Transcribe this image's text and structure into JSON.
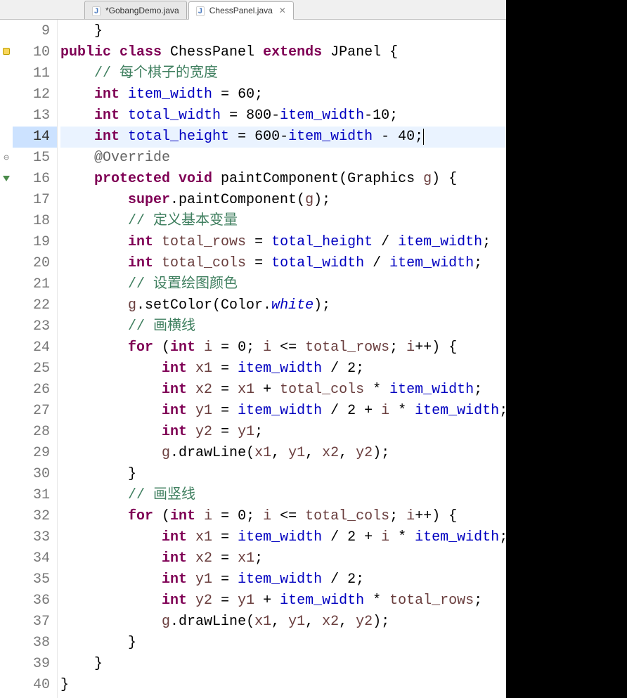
{
  "tabs": [
    {
      "label": "*GobangDemo.java",
      "active": false
    },
    {
      "label": "ChessPanel.java",
      "active": true
    }
  ],
  "gutter": {
    "lines": [
      "9",
      "10",
      "11",
      "12",
      "13",
      "14",
      "15",
      "16",
      "17",
      "18",
      "19",
      "20",
      "21",
      "22",
      "23",
      "24",
      "25",
      "26",
      "27",
      "28",
      "29",
      "30",
      "31",
      "32",
      "33",
      "34",
      "35",
      "36",
      "37",
      "38",
      "39",
      "40"
    ],
    "current_line": "14"
  },
  "markers": {
    "9": "",
    "10": "warn",
    "15": "fold",
    "16": "override"
  },
  "code": {
    "l9": {
      "indent": "    ",
      "tokens": [
        [
          "plain",
          "}"
        ]
      ]
    },
    "l10": {
      "indent": "",
      "tokens": [
        [
          "kw",
          "public class "
        ],
        [
          "plain",
          "ChessPanel "
        ],
        [
          "kw",
          "extends "
        ],
        [
          "plain",
          "JPanel {"
        ]
      ]
    },
    "l11": {
      "indent": "    ",
      "tokens": [
        [
          "comment",
          "// 每个棋子的宽度"
        ]
      ]
    },
    "l12": {
      "indent": "    ",
      "tokens": [
        [
          "kw",
          "int "
        ],
        [
          "field",
          "item_width"
        ],
        [
          "plain",
          " = 60;"
        ]
      ]
    },
    "l13": {
      "indent": "    ",
      "tokens": [
        [
          "kw",
          "int "
        ],
        [
          "field",
          "total_width"
        ],
        [
          "plain",
          " = 800-"
        ],
        [
          "field",
          "item_width"
        ],
        [
          "plain",
          "-10;"
        ]
      ]
    },
    "l14": {
      "indent": "    ",
      "tokens": [
        [
          "kw",
          "int "
        ],
        [
          "field",
          "total_height"
        ],
        [
          "plain",
          " = 600-"
        ],
        [
          "field",
          "item_width"
        ],
        [
          "plain",
          " - 40;"
        ]
      ]
    },
    "l15": {
      "indent": "    ",
      "tokens": [
        [
          "annot",
          "@Override"
        ]
      ]
    },
    "l16": {
      "indent": "    ",
      "tokens": [
        [
          "kw",
          "protected void "
        ],
        [
          "method",
          "paintComponent"
        ],
        [
          "plain",
          "(Graphics "
        ],
        [
          "local",
          "g"
        ],
        [
          "plain",
          ") {"
        ]
      ]
    },
    "l17": {
      "indent": "        ",
      "tokens": [
        [
          "kw",
          "super"
        ],
        [
          "plain",
          ".paintComponent("
        ],
        [
          "local",
          "g"
        ],
        [
          "plain",
          ");"
        ]
      ]
    },
    "l18": {
      "indent": "        ",
      "tokens": [
        [
          "comment",
          "// 定义基本变量"
        ]
      ]
    },
    "l19": {
      "indent": "        ",
      "tokens": [
        [
          "kw",
          "int "
        ],
        [
          "local",
          "total_rows"
        ],
        [
          "plain",
          " = "
        ],
        [
          "field",
          "total_height"
        ],
        [
          "plain",
          " / "
        ],
        [
          "field",
          "item_width"
        ],
        [
          "plain",
          ";"
        ]
      ]
    },
    "l20": {
      "indent": "        ",
      "tokens": [
        [
          "kw",
          "int "
        ],
        [
          "local",
          "total_cols"
        ],
        [
          "plain",
          " = "
        ],
        [
          "field",
          "total_width"
        ],
        [
          "plain",
          " / "
        ],
        [
          "field",
          "item_width"
        ],
        [
          "plain",
          ";"
        ]
      ]
    },
    "l21": {
      "indent": "        ",
      "tokens": [
        [
          "comment",
          "// 设置绘图颜色"
        ]
      ]
    },
    "l22": {
      "indent": "        ",
      "tokens": [
        [
          "local",
          "g"
        ],
        [
          "plain",
          ".setColor(Color."
        ],
        [
          "italic",
          "white"
        ],
        [
          "plain",
          ");"
        ]
      ]
    },
    "l23": {
      "indent": "        ",
      "tokens": [
        [
          "comment",
          "// 画横线"
        ]
      ]
    },
    "l24": {
      "indent": "        ",
      "tokens": [
        [
          "kw",
          "for "
        ],
        [
          "plain",
          "("
        ],
        [
          "kw",
          "int "
        ],
        [
          "local",
          "i"
        ],
        [
          "plain",
          " = 0; "
        ],
        [
          "local",
          "i"
        ],
        [
          "plain",
          " <= "
        ],
        [
          "local",
          "total_rows"
        ],
        [
          "plain",
          "; "
        ],
        [
          "local",
          "i"
        ],
        [
          "plain",
          "++) {"
        ]
      ]
    },
    "l25": {
      "indent": "            ",
      "tokens": [
        [
          "kw",
          "int "
        ],
        [
          "local",
          "x1"
        ],
        [
          "plain",
          " = "
        ],
        [
          "field",
          "item_width"
        ],
        [
          "plain",
          " / 2;"
        ]
      ]
    },
    "l26": {
      "indent": "            ",
      "tokens": [
        [
          "kw",
          "int "
        ],
        [
          "local",
          "x2"
        ],
        [
          "plain",
          " = "
        ],
        [
          "local",
          "x1"
        ],
        [
          "plain",
          " + "
        ],
        [
          "local",
          "total_cols"
        ],
        [
          "plain",
          " * "
        ],
        [
          "field",
          "item_width"
        ],
        [
          "plain",
          ";"
        ]
      ]
    },
    "l27": {
      "indent": "            ",
      "tokens": [
        [
          "kw",
          "int "
        ],
        [
          "local",
          "y1"
        ],
        [
          "plain",
          " = "
        ],
        [
          "field",
          "item_width"
        ],
        [
          "plain",
          " / 2 + "
        ],
        [
          "local",
          "i"
        ],
        [
          "plain",
          " * "
        ],
        [
          "field",
          "item_width"
        ],
        [
          "plain",
          ";"
        ]
      ]
    },
    "l28": {
      "indent": "            ",
      "tokens": [
        [
          "kw",
          "int "
        ],
        [
          "local",
          "y2"
        ],
        [
          "plain",
          " = "
        ],
        [
          "local",
          "y1"
        ],
        [
          "plain",
          ";"
        ]
      ]
    },
    "l29": {
      "indent": "            ",
      "tokens": [
        [
          "local",
          "g"
        ],
        [
          "plain",
          ".drawLine("
        ],
        [
          "local",
          "x1"
        ],
        [
          "plain",
          ", "
        ],
        [
          "local",
          "y1"
        ],
        [
          "plain",
          ", "
        ],
        [
          "local",
          "x2"
        ],
        [
          "plain",
          ", "
        ],
        [
          "local",
          "y2"
        ],
        [
          "plain",
          ");"
        ]
      ]
    },
    "l30": {
      "indent": "        ",
      "tokens": [
        [
          "plain",
          "}"
        ]
      ]
    },
    "l31": {
      "indent": "        ",
      "tokens": [
        [
          "comment",
          "// 画竖线"
        ]
      ]
    },
    "l32": {
      "indent": "        ",
      "tokens": [
        [
          "kw",
          "for "
        ],
        [
          "plain",
          "("
        ],
        [
          "kw",
          "int "
        ],
        [
          "local",
          "i"
        ],
        [
          "plain",
          " = 0; "
        ],
        [
          "local",
          "i"
        ],
        [
          "plain",
          " <= "
        ],
        [
          "local",
          "total_cols"
        ],
        [
          "plain",
          "; "
        ],
        [
          "local",
          "i"
        ],
        [
          "plain",
          "++) {"
        ]
      ]
    },
    "l33": {
      "indent": "            ",
      "tokens": [
        [
          "kw",
          "int "
        ],
        [
          "local",
          "x1"
        ],
        [
          "plain",
          " = "
        ],
        [
          "field",
          "item_width"
        ],
        [
          "plain",
          " / 2 + "
        ],
        [
          "local",
          "i"
        ],
        [
          "plain",
          " * "
        ],
        [
          "field",
          "item_width"
        ],
        [
          "plain",
          ";"
        ]
      ]
    },
    "l34": {
      "indent": "            ",
      "tokens": [
        [
          "kw",
          "int "
        ],
        [
          "local",
          "x2"
        ],
        [
          "plain",
          " = "
        ],
        [
          "local",
          "x1"
        ],
        [
          "plain",
          ";"
        ]
      ]
    },
    "l35": {
      "indent": "            ",
      "tokens": [
        [
          "kw",
          "int "
        ],
        [
          "local",
          "y1"
        ],
        [
          "plain",
          " = "
        ],
        [
          "field",
          "item_width"
        ],
        [
          "plain",
          " / 2;"
        ]
      ]
    },
    "l36": {
      "indent": "            ",
      "tokens": [
        [
          "kw",
          "int "
        ],
        [
          "local",
          "y2"
        ],
        [
          "plain",
          " = "
        ],
        [
          "local",
          "y1"
        ],
        [
          "plain",
          " + "
        ],
        [
          "field",
          "item_width"
        ],
        [
          "plain",
          " * "
        ],
        [
          "local",
          "total_rows"
        ],
        [
          "plain",
          ";"
        ]
      ]
    },
    "l37": {
      "indent": "            ",
      "tokens": [
        [
          "local",
          "g"
        ],
        [
          "plain",
          ".drawLine("
        ],
        [
          "local",
          "x1"
        ],
        [
          "plain",
          ", "
        ],
        [
          "local",
          "y1"
        ],
        [
          "plain",
          ", "
        ],
        [
          "local",
          "x2"
        ],
        [
          "plain",
          ", "
        ],
        [
          "local",
          "y2"
        ],
        [
          "plain",
          ");"
        ]
      ]
    },
    "l38": {
      "indent": "        ",
      "tokens": [
        [
          "plain",
          "}"
        ]
      ]
    },
    "l39": {
      "indent": "    ",
      "tokens": [
        [
          "plain",
          "}"
        ]
      ]
    },
    "l40": {
      "indent": "",
      "tokens": [
        [
          "plain",
          "}"
        ]
      ]
    }
  }
}
